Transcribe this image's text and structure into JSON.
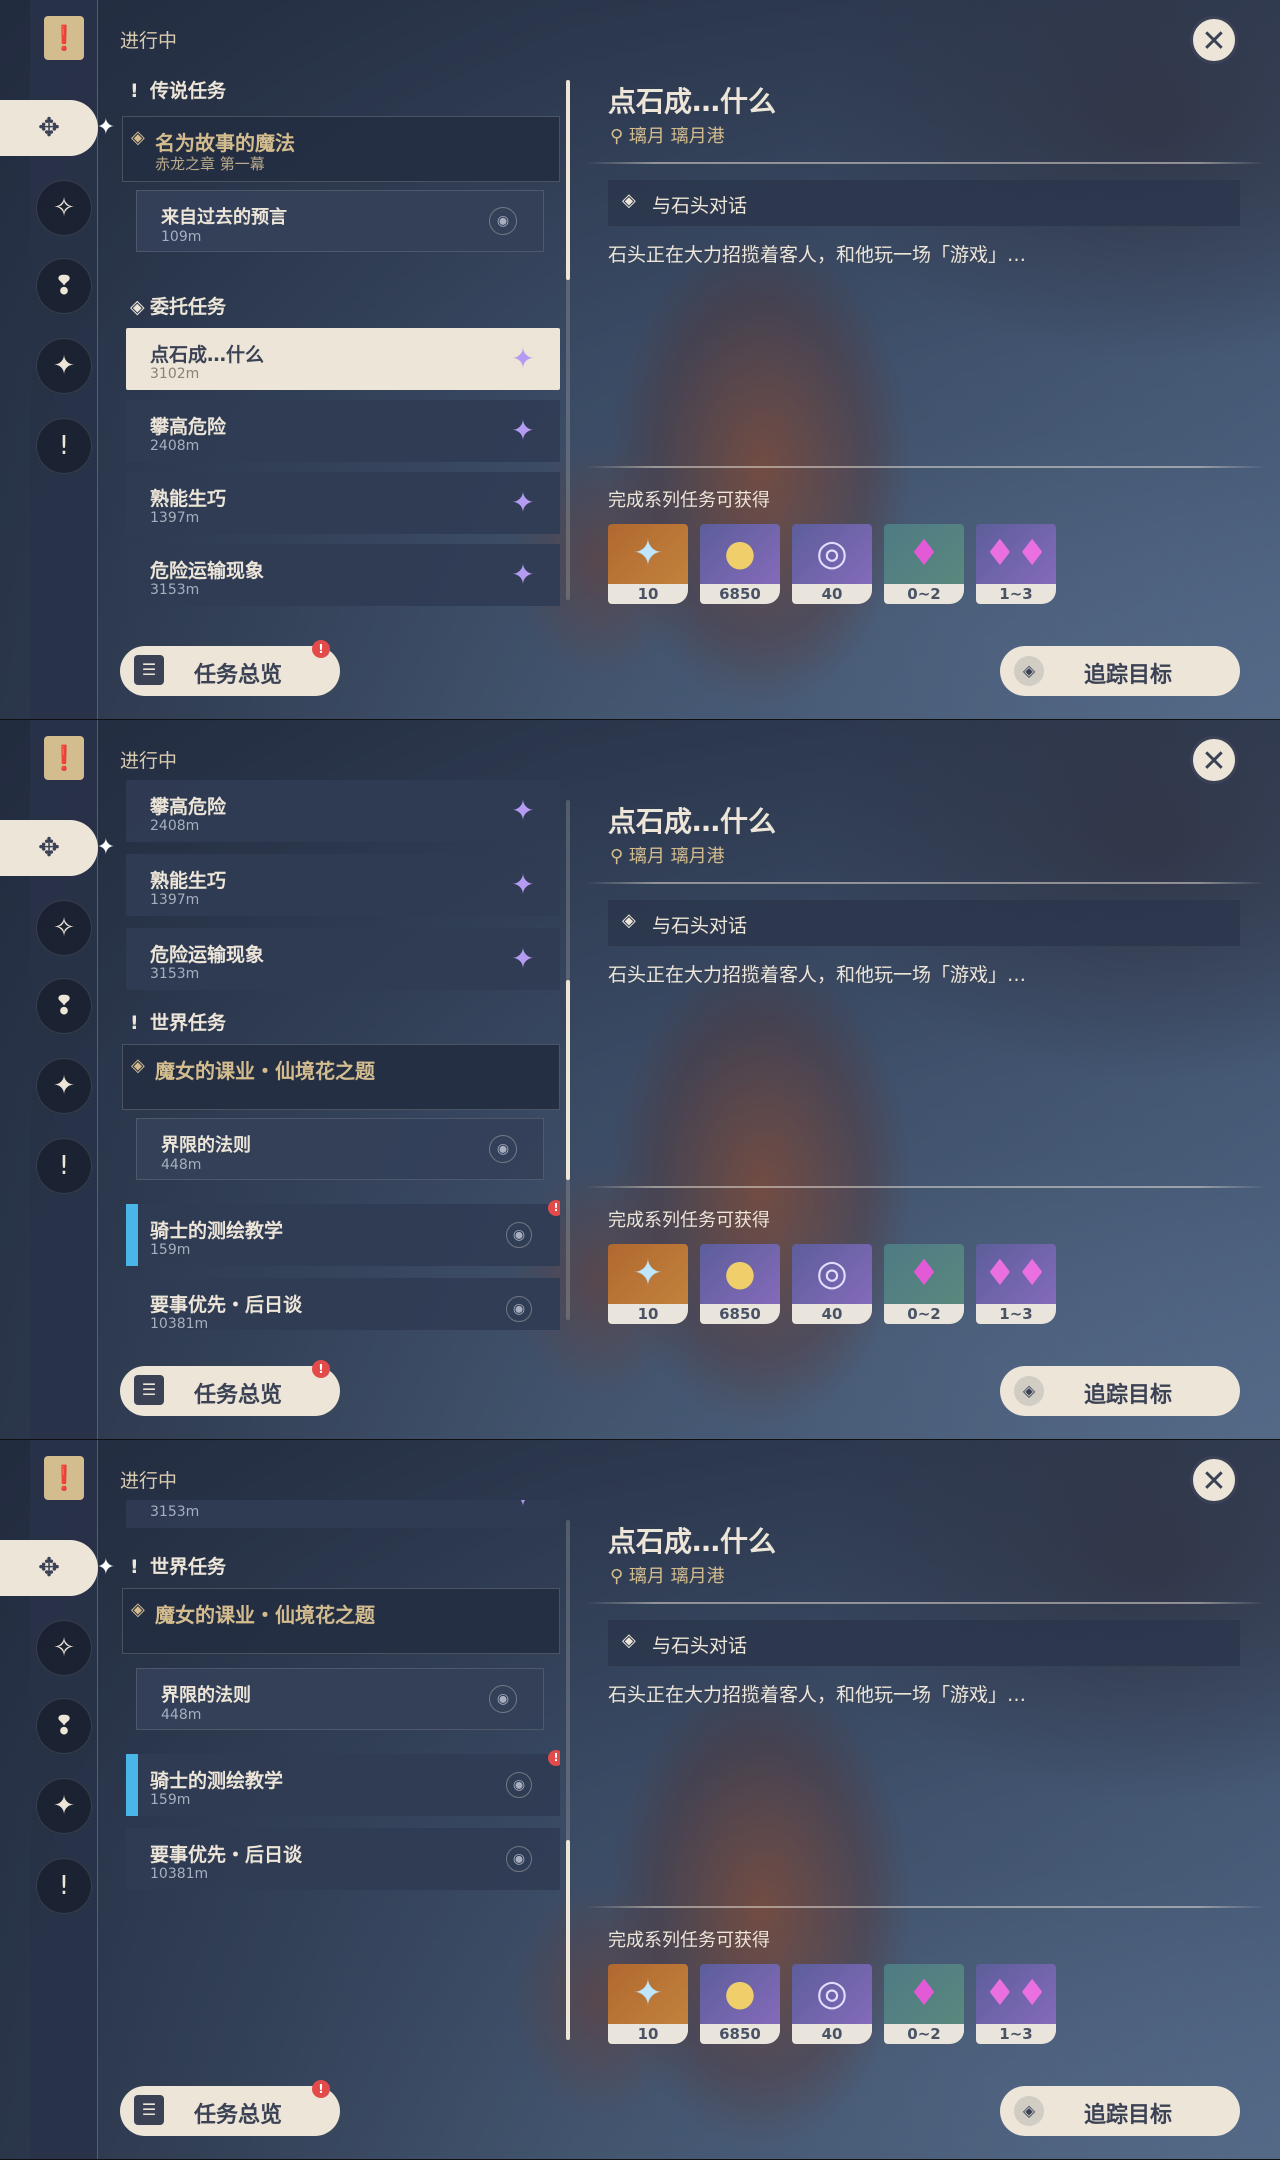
{
  "status_label": "进行中",
  "close_symbol": "✕",
  "category": {
    "archon": "传说任务",
    "commission": "委托任务",
    "world": "世界任务"
  },
  "archon_quest": {
    "title": "名为故事的魔法",
    "subtitle": "赤龙之章 第一幕",
    "sub_title": "来自过去的预言",
    "sub_dist": "109m"
  },
  "commissions": [
    {
      "title": "点石成…什么",
      "dist": "3102m"
    },
    {
      "title": "攀高危险",
      "dist": "2408m"
    },
    {
      "title": "熟能生巧",
      "dist": "1397m"
    },
    {
      "title": "危险运输现象",
      "dist": "3153m"
    }
  ],
  "world_archon": {
    "title": "魔女的课业・仙境花之题",
    "sub_title": "界限的法则",
    "sub_dist": "448m"
  },
  "world_quests": [
    {
      "title": "骑士的测绘教学",
      "dist": "159m"
    },
    {
      "title": "要事优先・后日谈",
      "dist": "10381m"
    }
  ],
  "detail": {
    "title": "点石成…什么",
    "location": "璃月 璃月港",
    "step": "与石头对话",
    "description": "石头正在大力招揽着客人，和他玩一场「游戏」…",
    "reward_label": "完成系列任务可获得",
    "rewards": [
      {
        "icon": "primogem-icon",
        "count": "10"
      },
      {
        "icon": "mora-icon",
        "count": "6850"
      },
      {
        "icon": "adventure-exp-icon",
        "count": "40"
      },
      {
        "icon": "crystal-chunk-icon",
        "count": "0~2"
      },
      {
        "icon": "crystal-cluster-icon",
        "count": "1~3"
      }
    ]
  },
  "buttons": {
    "overview": "任务总览",
    "track": "追踪目标"
  },
  "badge": "!",
  "colors": {
    "accent_gold": "#d3bc8e",
    "cream": "#ece5d8",
    "tracked_blue": "#4ab6e8",
    "alert_red": "#e34a4a",
    "commission_purple": "#b59cf2"
  }
}
